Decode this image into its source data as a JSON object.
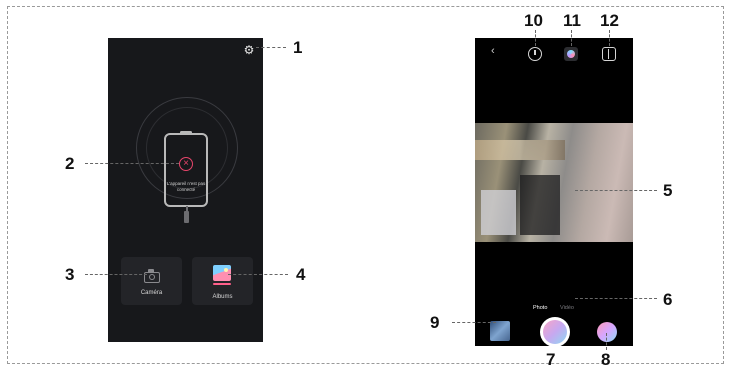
{
  "left_screen": {
    "status_text": "L'appareil n'est pas connecté",
    "camera_tile_label": "Caméra",
    "albums_tile_label": "Albums"
  },
  "right_screen": {
    "mode_photo": "Photo",
    "mode_video": "Vidéo",
    "back_glyph": "‹"
  },
  "callouts": [
    "1",
    "2",
    "3",
    "4",
    "5",
    "6",
    "7",
    "8",
    "9",
    "10",
    "11",
    "12"
  ],
  "icons": {
    "settings": "gear-icon",
    "disconnected": "x-circle-icon",
    "camera": "camera-icon",
    "albums": "photo-album-icon",
    "timer": "timer-icon",
    "color": "color-palette-icon",
    "layout": "layout-icon"
  },
  "colors": {
    "accent_pink": "#e8456b",
    "phone_bg": "#17181b"
  }
}
